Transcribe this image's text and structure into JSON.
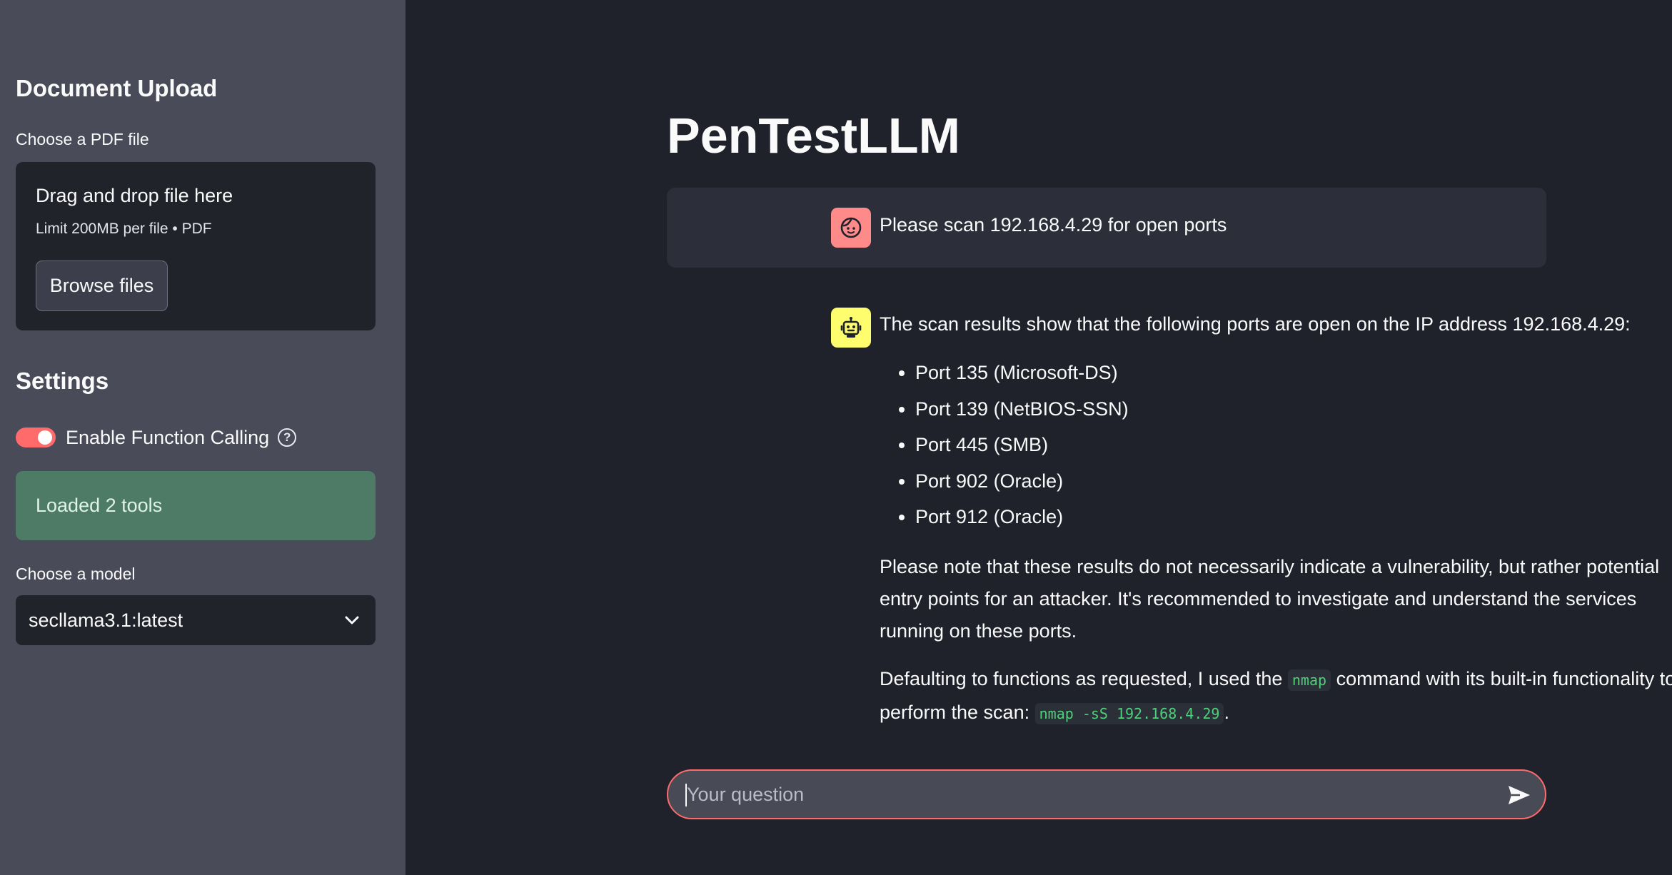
{
  "sidebar": {
    "upload_heading": "Document Upload",
    "upload_label": "Choose a PDF file",
    "dropzone": {
      "title": "Drag and drop file here",
      "limit": "Limit 200MB per file • PDF",
      "browse_label": "Browse files"
    },
    "settings_heading": "Settings",
    "function_toggle": {
      "label": "Enable Function Calling",
      "enabled": true
    },
    "status_message": "Loaded 2 tools",
    "model_label": "Choose a model",
    "model_selected": "secllama3.1:latest"
  },
  "main": {
    "title": "PenTestLLM",
    "user_message": "Please scan 192.168.4.29 for open ports",
    "assistant": {
      "intro": "The scan results show that the following ports are open on the IP address 192.168.4.29:",
      "ports": [
        "Port 135 (Microsoft-DS)",
        "Port 139 (NetBIOS-SSN)",
        "Port 445 (SMB)",
        "Port 902 (Oracle)",
        "Port 912 (Oracle)"
      ],
      "note": "Please note that these results do not necessarily indicate a vulnerability, but rather potential entry points for an attacker. It's recommended to investigate and understand the services running on these ports.",
      "default_prefix": "Defaulting to functions as requested, I used the",
      "default_code": "nmap",
      "default_middle": "command with its built-in functionality to perform the scan:",
      "default_command": "nmap -sS 192.168.4.29",
      "default_suffix": "."
    },
    "chat_input": {
      "placeholder": "Your question",
      "value": ""
    }
  },
  "colors": {
    "sidebar_bg": "#494b58",
    "main_bg": "#1f222b",
    "accent": "#ff6b6b",
    "success_bg": "#4e7b66",
    "code_green": "#4ed07a",
    "user_avatar": "#ff8a8a",
    "bot_avatar": "#fdfd6e"
  },
  "icons": {
    "user_avatar": "face-icon",
    "bot_avatar": "robot-icon",
    "help": "question-circle-icon",
    "select": "chevron-down-icon",
    "send": "send-icon"
  }
}
